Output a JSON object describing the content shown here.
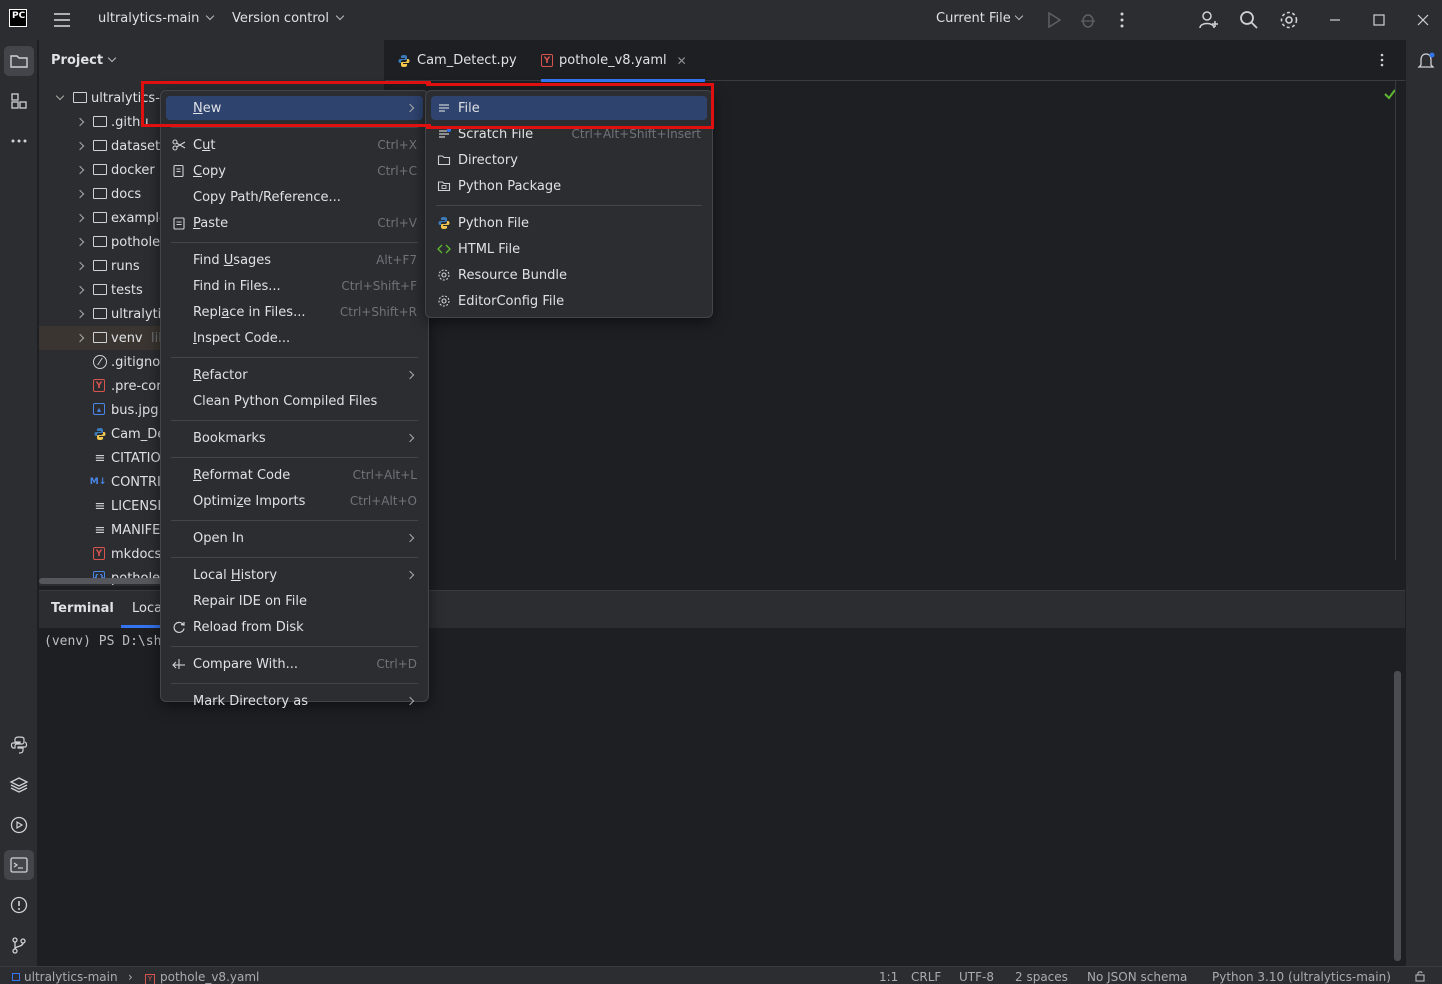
{
  "titlebar": {
    "project": "ultralytics-main",
    "vcs": "Version control",
    "run_config": "Current File"
  },
  "project_panel": {
    "title": "Project",
    "tree": [
      {
        "label": "ultralytics-r",
        "type": "folder",
        "expanded": true,
        "depth": 0
      },
      {
        "label": ".githu",
        "type": "folder",
        "depth": 1
      },
      {
        "label": "datasets",
        "type": "folder",
        "depth": 1
      },
      {
        "label": "docker",
        "type": "folder",
        "depth": 1
      },
      {
        "label": "docs",
        "type": "folder",
        "depth": 1
      },
      {
        "label": "example",
        "type": "folder",
        "depth": 1
      },
      {
        "label": "pothole_",
        "type": "folder",
        "depth": 1
      },
      {
        "label": "runs",
        "type": "folder",
        "depth": 1
      },
      {
        "label": "tests",
        "type": "folder",
        "depth": 1
      },
      {
        "label": "ultralytic",
        "type": "package",
        "depth": 1
      },
      {
        "label": "venv",
        "suffix": "lib",
        "type": "folder",
        "depth": 1,
        "selected": true
      },
      {
        "label": ".gitignor",
        "type": "ignore",
        "depth": 1
      },
      {
        "label": ".pre-cor",
        "type": "yaml",
        "depth": 1
      },
      {
        "label": "bus.jpg",
        "type": "image",
        "depth": 1
      },
      {
        "label": "Cam_De",
        "type": "python",
        "depth": 1
      },
      {
        "label": "CITATIO",
        "type": "text",
        "depth": 1
      },
      {
        "label": "CONTRI",
        "type": "markdown",
        "depth": 1
      },
      {
        "label": "LICENSE",
        "type": "text",
        "depth": 1
      },
      {
        "label": "MANIFE",
        "type": "text",
        "depth": 1
      },
      {
        "label": "mkdocs.",
        "type": "yaml",
        "depth": 1
      },
      {
        "label": "pothole_",
        "type": "json",
        "depth": 1
      }
    ]
  },
  "editor": {
    "tabs": [
      {
        "label": "Cam_Detect.py",
        "active": false
      },
      {
        "label": "pothole_v8.yaml",
        "active": true
      }
    ]
  },
  "terminal": {
    "title": "Terminal",
    "tab": "Local",
    "line": "(venv) PS D:\\sh"
  },
  "context_menu": {
    "items": [
      {
        "label": "New",
        "submenu": true,
        "highlight": true
      },
      {
        "sep": true
      },
      {
        "label": "Cut",
        "shortcut": "Ctrl+X",
        "icon": "scissors-icon"
      },
      {
        "label": "Copy",
        "shortcut": "Ctrl+C",
        "icon": "copy-icon"
      },
      {
        "label": "Copy Path/Reference..."
      },
      {
        "label": "Paste",
        "shortcut": "Ctrl+V",
        "icon": "paste-icon"
      },
      {
        "sep": true
      },
      {
        "label": "Find Usages",
        "shortcut": "Alt+F7"
      },
      {
        "label": "Find in Files...",
        "shortcut": "Ctrl+Shift+F"
      },
      {
        "label": "Replace in Files...",
        "shortcut": "Ctrl+Shift+R"
      },
      {
        "label": "Inspect Code..."
      },
      {
        "sep": true
      },
      {
        "label": "Refactor",
        "submenu": true
      },
      {
        "label": "Clean Python Compiled Files"
      },
      {
        "sep": true
      },
      {
        "label": "Bookmarks",
        "submenu": true
      },
      {
        "sep": true
      },
      {
        "label": "Reformat Code",
        "shortcut": "Ctrl+Alt+L"
      },
      {
        "label": "Optimize Imports",
        "shortcut": "Ctrl+Alt+O"
      },
      {
        "sep": true
      },
      {
        "label": "Open In",
        "submenu": true
      },
      {
        "sep": true
      },
      {
        "label": "Local History",
        "submenu": true
      },
      {
        "label": "Repair IDE on File"
      },
      {
        "label": "Reload from Disk",
        "icon": "reload-icon"
      },
      {
        "sep": true
      },
      {
        "label": "Compare With...",
        "shortcut": "Ctrl+D",
        "icon": "compare-icon"
      },
      {
        "sep": true
      },
      {
        "label": "Mark Directory as",
        "submenu": true
      }
    ]
  },
  "new_submenu": {
    "items": [
      {
        "label": "File",
        "icon": "file-lines-icon",
        "highlight": true
      },
      {
        "label": "Scratch File",
        "shortcut": "Ctrl+Alt+Shift+Insert",
        "icon": "scratch-file-icon"
      },
      {
        "label": "Directory",
        "icon": "folder-icon"
      },
      {
        "label": "Python Package",
        "icon": "package-icon"
      },
      {
        "sep": true
      },
      {
        "label": "Python File",
        "icon": "python-icon"
      },
      {
        "label": "HTML File",
        "icon": "html-icon"
      },
      {
        "label": "Resource Bundle",
        "icon": "gear-icon"
      },
      {
        "label": "EditorConfig File",
        "icon": "gear-icon"
      }
    ]
  },
  "statusbar": {
    "project": "ultralytics-main",
    "file": "pothole_v8.yaml",
    "position": "1:1",
    "line_sep": "CRLF",
    "encoding": "UTF-8",
    "indent": "2 spaces",
    "schema": "No JSON schema",
    "interpreter": "Python 3.10 (ultralytics-main)"
  },
  "colors": {
    "highlight": "#2e436e",
    "accent": "#3574f0",
    "annotation": "#e01010"
  }
}
